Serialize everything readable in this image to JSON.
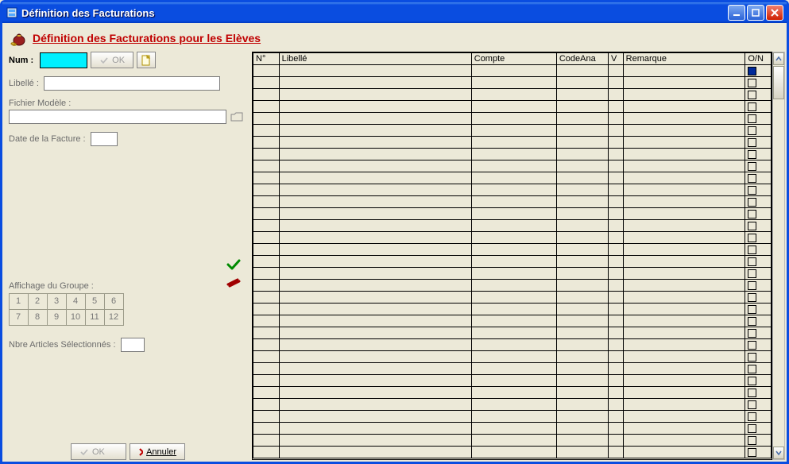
{
  "window": {
    "title": "Définition des Facturations"
  },
  "header": {
    "title": "Définition des Facturations pour les Elèves"
  },
  "left": {
    "num_label": "Num :",
    "num_value": "",
    "ok_btn": "OK",
    "libelle_label": "Libellé :",
    "libelle_value": "",
    "fichier_label": "Fichier Modèle :",
    "fichier_value": "",
    "date_label": "Date de la Facture :",
    "date_value": "",
    "groupe_label": "Affichage du Groupe :",
    "groupe_cells": [
      "1",
      "2",
      "3",
      "4",
      "5",
      "6",
      "7",
      "8",
      "9",
      "10",
      "11",
      "12"
    ],
    "nbre_label": "Nbre Articles Sélectionnés :",
    "nbre_value": ""
  },
  "buttons": {
    "ok": "OK",
    "annuler": "Annuler"
  },
  "grid": {
    "cols": [
      "N°",
      "Libellé",
      "Compte",
      "CodeAna",
      "V",
      "Remarque",
      "O/N"
    ],
    "row_count": 33
  }
}
